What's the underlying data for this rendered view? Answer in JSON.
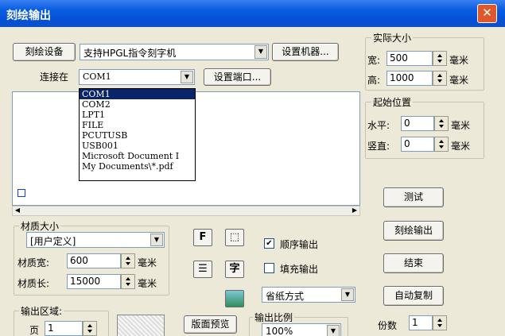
{
  "window": {
    "title": "刻绘输出",
    "close": "✕"
  },
  "device": {
    "label_button": "刻绘设备",
    "selected": "支持HPGL指令刻字机",
    "setup_button": "设置机器...",
    "connect_label": "连接在",
    "port_selected": "COM1",
    "port_button": "设置端口...",
    "port_options": [
      "COM1",
      "COM2",
      "LPT1",
      "FILE",
      "PCUTUSB",
      "USB001",
      "Microsoft Document I",
      "My Documents\\*.pdf"
    ]
  },
  "actual_size": {
    "title": "实际大小",
    "width_label": "宽:",
    "width_value": "500",
    "height_label": "高:",
    "height_value": "1000",
    "unit": "毫米"
  },
  "start_pos": {
    "title": "起始位置",
    "h_label": "水平:",
    "h_value": "0",
    "v_label": "竖直:",
    "v_value": "0",
    "unit": "毫米"
  },
  "material": {
    "title": "材质大小",
    "selected": "[用户定义]",
    "width_label": "材质宽:",
    "width_value": "600",
    "length_label": "材质长:",
    "length_value": "15000",
    "unit": "毫米"
  },
  "options": {
    "sequential": "顺序输出",
    "sequential_checked": "✔",
    "fill": "填充输出",
    "save_mode": "省纸方式"
  },
  "tools": {
    "f": "F",
    "mirror": "⬚",
    "lines": "☰",
    "char": "字"
  },
  "buttons": {
    "test": "测试",
    "output": "刻绘输出",
    "end": "结束",
    "auto_copy": "自动复制",
    "preview": "版面预览"
  },
  "copies": {
    "label": "份数",
    "value": "1"
  },
  "output_area": {
    "title": "输出区域:",
    "page_label": "页",
    "page_value": "1"
  },
  "scale": {
    "title": "输出比例",
    "value": "100%"
  }
}
